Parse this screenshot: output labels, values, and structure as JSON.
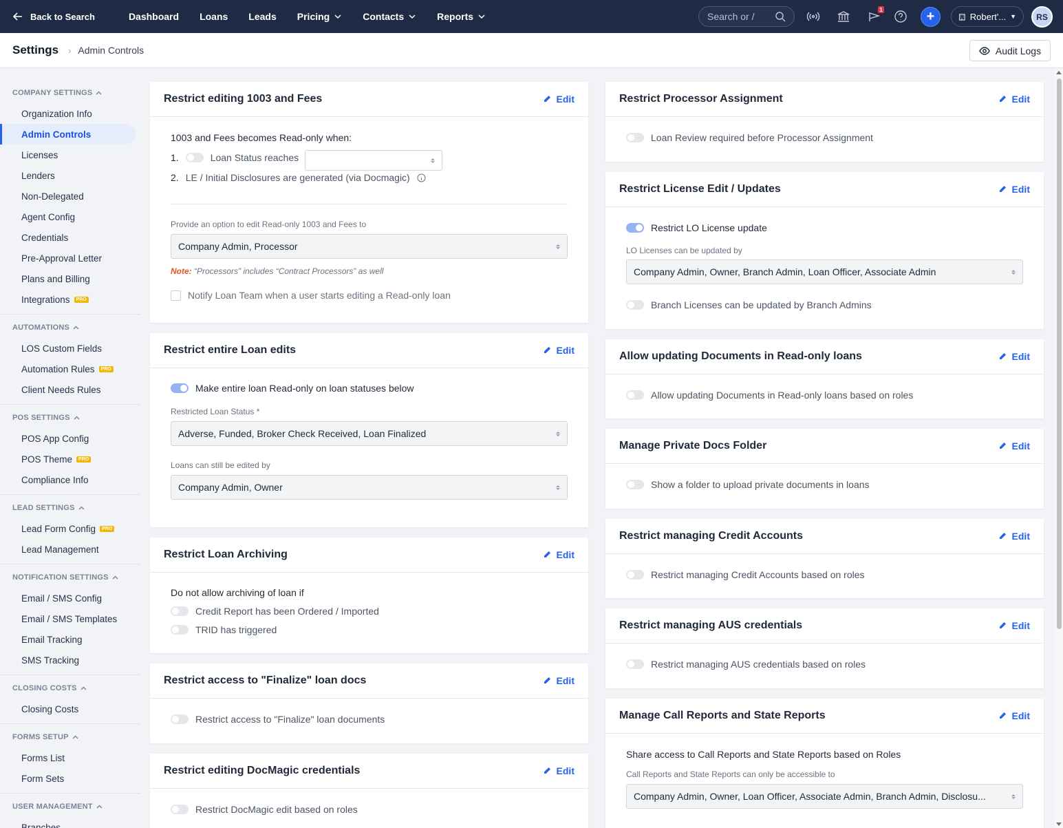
{
  "nav": {
    "back": "Back to Search",
    "items": [
      "Dashboard",
      "Loans",
      "Leads",
      "Pricing",
      "Contacts",
      "Reports"
    ],
    "search_placeholder": "Search or /",
    "notification_count": "1",
    "org": "Robert'...",
    "avatar": "RS"
  },
  "breadcrumb": {
    "title": "Settings",
    "current": "Admin Controls",
    "audit": "Audit Logs"
  },
  "sidebar": {
    "company": {
      "title": "COMPANY SETTINGS",
      "items": [
        "Organization Info",
        "Admin Controls",
        "Licenses",
        "Lenders",
        "Non-Delegated",
        "Agent Config",
        "Credentials",
        "Pre-Approval Letter",
        "Plans and Billing",
        "Integrations"
      ]
    },
    "automations": {
      "title": "AUTOMATIONS",
      "items": [
        "LOS Custom Fields",
        "Automation Rules",
        "Client Needs Rules"
      ]
    },
    "pos": {
      "title": "POS SETTINGS",
      "items": [
        "POS App Config",
        "POS Theme",
        "Compliance Info"
      ]
    },
    "lead": {
      "title": "LEAD SETTINGS",
      "items": [
        "Lead Form Config",
        "Lead Management"
      ]
    },
    "notification": {
      "title": "NOTIFICATION SETTINGS",
      "items": [
        "Email / SMS Config",
        "Email / SMS Templates",
        "Email Tracking",
        "SMS Tracking"
      ]
    },
    "closing": {
      "title": "CLOSING COSTS",
      "items": [
        "Closing Costs"
      ]
    },
    "forms": {
      "title": "FORMS SETUP",
      "items": [
        "Forms List",
        "Form Sets"
      ]
    },
    "user": {
      "title": "USER MANAGEMENT",
      "items": [
        "Branches"
      ]
    },
    "pro_label": "PRO"
  },
  "edit_label": "Edit",
  "cards": {
    "c1003": {
      "title": "Restrict editing 1003 and Fees",
      "intro": "1003 and Fees becomes Read-only when:",
      "n1": "1.",
      "status": "Loan Status reaches",
      "n2": "2.",
      "le": "LE / Initial Disclosures are generated (via Docmagic)",
      "option_label": "Provide an option to edit Read-only 1003 and Fees to",
      "option_value": "Company Admin, Processor",
      "note_prefix": "Note:",
      "note_text": " “Processors” includes “Contract Processors” as well",
      "notify": "Notify Loan Team when a user starts editing a Read-only loan"
    },
    "entire": {
      "title": "Restrict entire Loan edits",
      "toggle": "Make entire loan Read-only on loan statuses below",
      "status_label": "Restricted Loan Status *",
      "status_value": "Adverse, Funded, Broker Check Received, Loan Finalized",
      "edited_label": "Loans can still be edited by",
      "edited_value": "Company Admin, Owner"
    },
    "archiving": {
      "title": "Restrict Loan Archiving",
      "intro": "Do not allow archiving of loan if",
      "credit": "Credit Report has been Ordered / Imported",
      "trid": "TRID has triggered"
    },
    "finalize": {
      "title": "Restrict access to \"Finalize\" loan docs",
      "toggle": "Restrict access to \"Finalize\" loan documents"
    },
    "docmagic": {
      "title": "Restrict editing DocMagic credentials",
      "toggle": "Restrict DocMagic edit based on roles"
    },
    "processor": {
      "title": "Restrict Processor Assignment",
      "toggle": "Loan Review required before Processor Assignment"
    },
    "license": {
      "title": "Restrict License Edit / Updates",
      "toggle": "Restrict LO License update",
      "lo_label": "LO Licenses can be updated by",
      "lo_value": "Company Admin, Owner, Branch Admin, Loan Officer, Associate Admin",
      "branch": "Branch Licenses can be updated by Branch Admins"
    },
    "documents": {
      "title": "Allow updating Documents in Read-only loans",
      "toggle": "Allow updating Documents in Read-only loans based on roles"
    },
    "private": {
      "title": "Manage Private Docs Folder",
      "toggle": "Show a folder to upload private documents in loans"
    },
    "credit": {
      "title": "Restrict managing Credit Accounts",
      "toggle": "Restrict managing Credit Accounts based on roles"
    },
    "aus": {
      "title": "Restrict managing AUS credentials",
      "toggle": "Restrict managing AUS credentials based on roles"
    },
    "callreports": {
      "title": "Manage Call Reports and State Reports",
      "intro": "Share access to Call Reports and State Reports based on Roles",
      "access_label": "Call Reports and State Reports can only be accessible to",
      "access_value": "Company Admin, Owner, Loan Officer, Associate Admin, Branch Admin, Disclosu..."
    }
  }
}
